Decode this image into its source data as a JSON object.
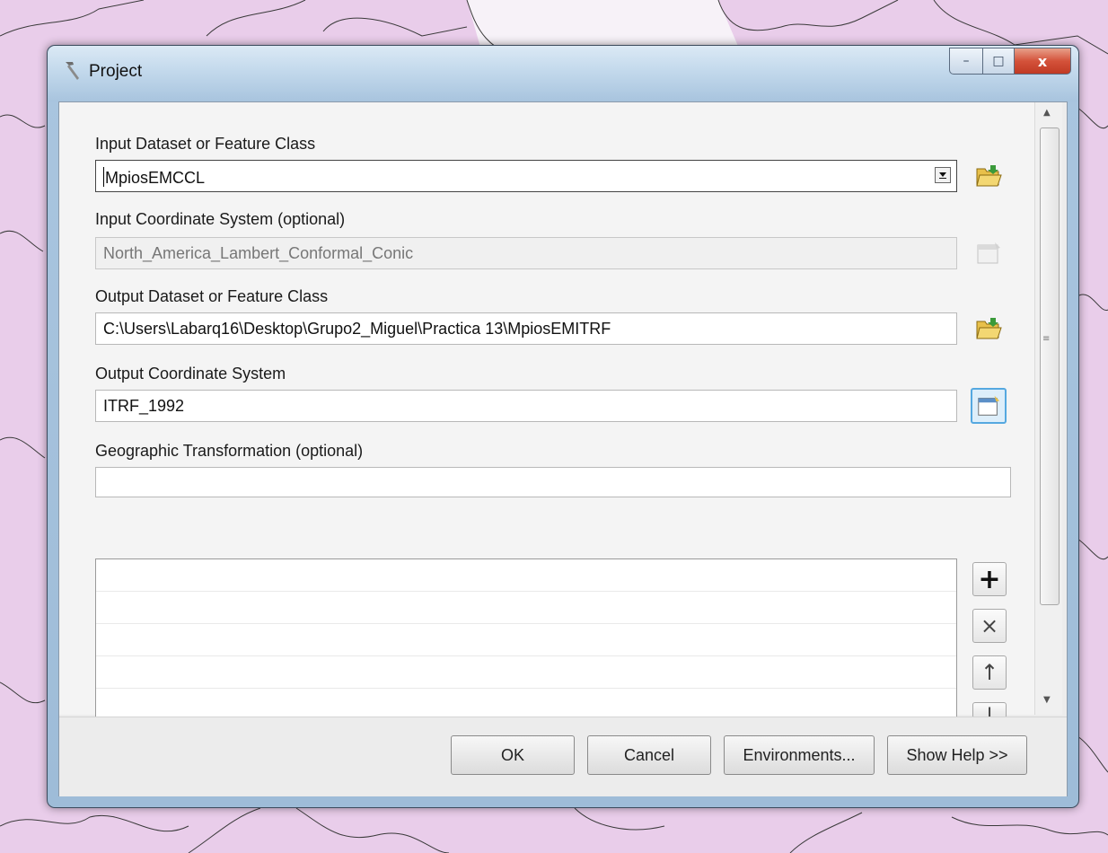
{
  "window": {
    "title": "Project",
    "caption_buttons": {
      "minimize": "–",
      "maximize": "□",
      "close": "x"
    }
  },
  "form": {
    "input_dataset_label": "Input Dataset or Feature Class",
    "input_dataset_value": "MpiosEMCCL",
    "input_cs_label": "Input Coordinate System (optional)",
    "input_cs_value": "North_America_Lambert_Conformal_Conic",
    "output_dataset_label": "Output Dataset or Feature Class",
    "output_dataset_value": "C:\\Users\\Labarq16\\Desktop\\Grupo2_Miguel\\Practica 13\\MpiosEMITRF",
    "output_cs_label": "Output Coordinate System",
    "output_cs_value": "ITRF_1992",
    "geo_transform_label": "Geographic Transformation (optional)",
    "geo_transform_value": ""
  },
  "list_buttons": {
    "add": "+",
    "remove": "×",
    "up": "↑",
    "down": "↓"
  },
  "footer": {
    "ok": "OK",
    "cancel": "Cancel",
    "environments": "Environments...",
    "show_help": "Show Help >>"
  },
  "colors": {
    "map_fill": "#e9cdea",
    "map_water": "#cfe3f5",
    "title_gradient": "#a8c4de",
    "close_button": "#c03a24",
    "active_border": "#55a8e0",
    "folder_icon": "#e8c04a"
  },
  "icons": {
    "title": "hammer-icon",
    "browse": "folder-open-icon",
    "properties": "spatial-reference-properties-icon"
  }
}
